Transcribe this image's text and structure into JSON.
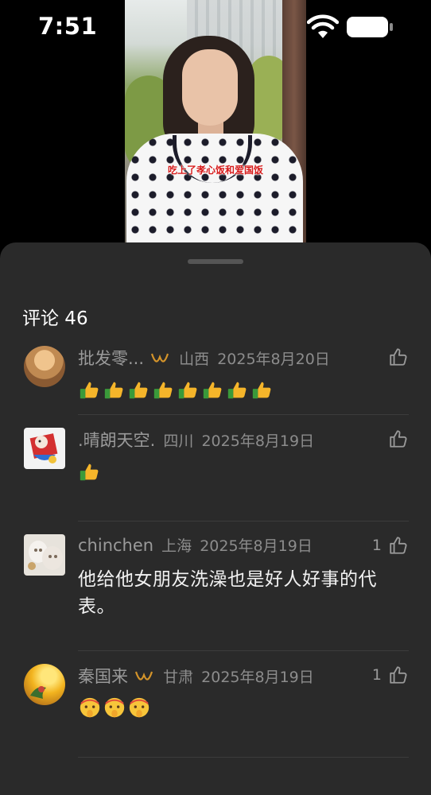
{
  "status_bar": {
    "time": "7:51"
  },
  "video": {
    "subtitle": "吃上了孝心饭和爱国饭"
  },
  "comment_sheet": {
    "title": "评论 46",
    "comments": [
      {
        "username": "批发零...",
        "badge": "heart-badge",
        "region": "山西",
        "date": "2025年8月20日",
        "like_count": "",
        "text": "",
        "emoji": [
          "thumbs-up",
          "thumbs-up",
          "thumbs-up",
          "thumbs-up",
          "thumbs-up",
          "thumbs-up",
          "thumbs-up",
          "thumbs-up"
        ]
      },
      {
        "username": ".晴朗天空.",
        "region": "四川",
        "date": "2025年8月19日",
        "like_count": "",
        "text": "",
        "emoji": [
          "thumbs-up"
        ]
      },
      {
        "username": "chinchen",
        "region": "上海",
        "date": "2025年8月19日",
        "like_count": "1",
        "text": "他给他女朋友洗澡也是好人好事的代表。"
      },
      {
        "username": "秦国来",
        "badge": "heart-badge",
        "region": "甘肃",
        "date": "2025年8月19日",
        "like_count": "1",
        "text": "",
        "emoji": [
          "shushing-face",
          "shushing-face",
          "shushing-face"
        ]
      }
    ]
  },
  "colors": {
    "sheet_background": "#2a2a2a",
    "meta_text": "#8c8c8c",
    "badge": "#d4942a",
    "subtitle": "#d61b1b"
  }
}
